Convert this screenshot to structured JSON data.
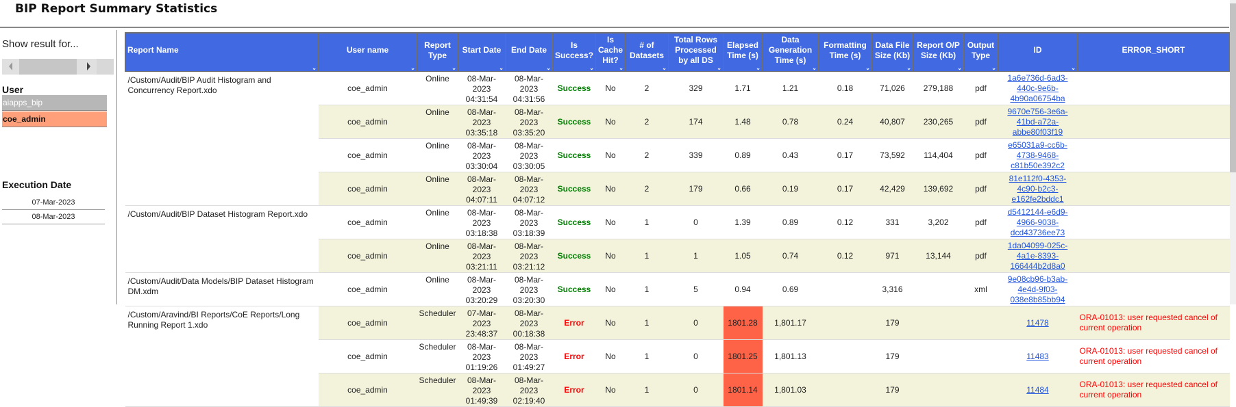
{
  "title": "BIP Report Summary Statistics",
  "sidebar": {
    "show_result_label": "Show result for...",
    "user_label": "User",
    "users": [
      "aiapps_bip",
      "coe_admin"
    ],
    "execution_date_label": "Execution Date",
    "dates": [
      "07-Mar-2023",
      "08-Mar-2023"
    ]
  },
  "colors": {
    "header": "#4169e1",
    "alt_row": "#f3f3dc",
    "success": "#008000",
    "error": "#ff0000",
    "highlight": "#ff6347",
    "selected_user": "#ffa07a"
  },
  "table": {
    "headers": [
      "Report Name",
      "User name",
      "Report Type",
      "Start Date",
      "End Date",
      "Is Success?",
      "Is Cache Hit?",
      "# of Datasets",
      "Total Rows Processed by all DS",
      "Elapsed Time (s)",
      "Data Generation Time (s)",
      "Formatting Time (s)",
      "Data File Size (Kb)",
      "Report O/P Size (Kb)",
      "Output Type",
      "ID",
      "ERROR_SHORT"
    ],
    "groups": [
      {
        "report": "/Custom/Audit/BIP Audit Histogram and Concurrency Report.xdo",
        "rows": [
          {
            "user": "coe_admin",
            "type": "Online",
            "start": "08-Mar-2023 04:31:54",
            "end": "08-Mar-2023 04:31:56",
            "status": "Success",
            "cache": "No",
            "datasets": "2",
            "rows": "329",
            "elapsed": "1.71",
            "datagen": "1.21",
            "fmt": "0.18",
            "dfs": "71,026",
            "ops": "279,188",
            "out": "pdf",
            "id": "1a6e736d-6ad3-440c-9e6b-4b90a06754ba",
            "error": ""
          },
          {
            "user": "coe_admin",
            "type": "Online",
            "start": "08-Mar-2023 03:35:18",
            "end": "08-Mar-2023 03:35:20",
            "status": "Success",
            "cache": "No",
            "datasets": "2",
            "rows": "174",
            "elapsed": "1.48",
            "datagen": "0.78",
            "fmt": "0.24",
            "dfs": "40,807",
            "ops": "230,265",
            "out": "pdf",
            "id": "9670e756-3e6a-41bd-a72a-abbe80f03f19",
            "error": ""
          },
          {
            "user": "coe_admin",
            "type": "Online",
            "start": "08-Mar-2023 03:30:04",
            "end": "08-Mar-2023 03:30:05",
            "status": "Success",
            "cache": "No",
            "datasets": "2",
            "rows": "339",
            "elapsed": "0.89",
            "datagen": "0.43",
            "fmt": "0.17",
            "dfs": "73,592",
            "ops": "114,404",
            "out": "pdf",
            "id": "e65031a9-cc6b-4738-9468-c81b50e392c2",
            "error": ""
          },
          {
            "user": "coe_admin",
            "type": "Online",
            "start": "08-Mar-2023 04:07:11",
            "end": "08-Mar-2023 04:07:12",
            "status": "Success",
            "cache": "No",
            "datasets": "2",
            "rows": "179",
            "elapsed": "0.66",
            "datagen": "0.19",
            "fmt": "0.17",
            "dfs": "42,429",
            "ops": "139,692",
            "out": "pdf",
            "id": "81e112f0-4353-4c90-b2c3-e162fe2bddc1",
            "error": ""
          }
        ]
      },
      {
        "report": "/Custom/Audit/BIP Dataset Histogram Report.xdo",
        "rows": [
          {
            "user": "coe_admin",
            "type": "Online",
            "start": "08-Mar-2023 03:18:38",
            "end": "08-Mar-2023 03:18:39",
            "status": "Success",
            "cache": "No",
            "datasets": "1",
            "rows": "0",
            "elapsed": "1.39",
            "datagen": "0.89",
            "fmt": "0.12",
            "dfs": "331",
            "ops": "3,202",
            "out": "pdf",
            "id": "d5412144-e6d9-4966-9038-dcd43736ee73",
            "error": ""
          },
          {
            "user": "coe_admin",
            "type": "Online",
            "start": "08-Mar-2023 03:21:11",
            "end": "08-Mar-2023 03:21:12",
            "status": "Success",
            "cache": "No",
            "datasets": "1",
            "rows": "1",
            "elapsed": "1.05",
            "datagen": "0.74",
            "fmt": "0.12",
            "dfs": "971",
            "ops": "13,144",
            "out": "pdf",
            "id": "1da04099-025c-4a1e-8393-166444b2d8a0",
            "error": ""
          }
        ]
      },
      {
        "report": "/Custom/Audit/Data Models/BIP Dataset Histogram DM.xdm",
        "rows": [
          {
            "user": "coe_admin",
            "type": "Online",
            "start": "08-Mar-2023 03:20:29",
            "end": "08-Mar-2023 03:20:30",
            "status": "Success",
            "cache": "No",
            "datasets": "1",
            "rows": "5",
            "elapsed": "0.94",
            "datagen": "0.69",
            "fmt": "",
            "dfs": "3,316",
            "ops": "",
            "out": "xml",
            "id": "9e08cb96-b3ab-4e4d-9f03-038e8b85bb94",
            "error": ""
          }
        ]
      },
      {
        "report": "/Custom/Aravind/BI Reports/CoE Reports/Long Running Report 1.xdo",
        "rows": [
          {
            "user": "coe_admin",
            "type": "Scheduler",
            "start": "07-Mar-2023 23:48:37",
            "end": "08-Mar-2023 00:18:38",
            "status": "Error",
            "cache": "No",
            "datasets": "1",
            "rows": "0",
            "elapsed": "1801.28",
            "datagen": "1,801.17",
            "fmt": "",
            "dfs": "179",
            "ops": "",
            "out": "",
            "id": "11478",
            "error": "ORA-01013: user requested cancel of current operation"
          },
          {
            "user": "coe_admin",
            "type": "Scheduler",
            "start": "08-Mar-2023 01:19:26",
            "end": "08-Mar-2023 01:49:27",
            "status": "Error",
            "cache": "No",
            "datasets": "1",
            "rows": "0",
            "elapsed": "1801.25",
            "datagen": "1,801.13",
            "fmt": "",
            "dfs": "179",
            "ops": "",
            "out": "",
            "id": "11483",
            "error": "ORA-01013: user requested cancel of current operation"
          },
          {
            "user": "coe_admin",
            "type": "Scheduler",
            "start": "08-Mar-2023 01:49:39",
            "end": "08-Mar-2023 02:19:40",
            "status": "Error",
            "cache": "No",
            "datasets": "1",
            "rows": "0",
            "elapsed": "1801.14",
            "datagen": "1,801.03",
            "fmt": "",
            "dfs": "179",
            "ops": "",
            "out": "",
            "id": "11484",
            "error": "ORA-01013: user requested cancel of current operation"
          }
        ]
      }
    ]
  }
}
